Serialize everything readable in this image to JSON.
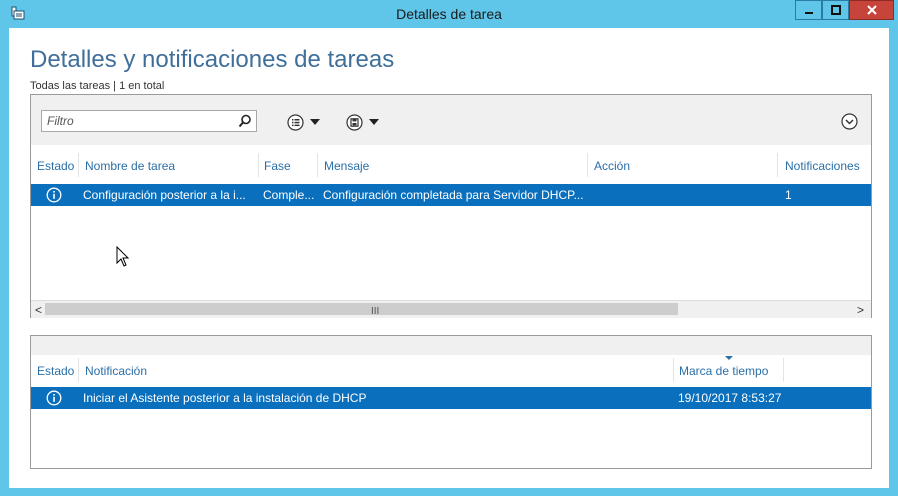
{
  "window": {
    "title": "Detalles de tarea",
    "icon": "server-manager-icon"
  },
  "controls": {
    "minimize": "minimize-icon",
    "maximize": "maximize-icon",
    "close": "close-icon"
  },
  "heading": "Detalles y notificaciones de tareas",
  "summary": "Todas las tareas | 1 en total",
  "toolbar": {
    "filter_placeholder": "Filtro",
    "search_icon": "search-icon",
    "list_icon": "list-options-icon",
    "save_icon": "save-icon",
    "expand_icon": "expand-chevron-icon"
  },
  "tasks": {
    "columns": [
      "Estado",
      "Nombre de tarea",
      "Fase",
      "Mensaje",
      "Acción",
      "Notificaciones"
    ],
    "rows": [
      {
        "status_icon": "info-icon",
        "name": "Configuración posterior a la i...",
        "phase": "Comple...",
        "message": "Configuración completada para Servidor DHCP...",
        "action": "",
        "notifications": "1"
      }
    ],
    "scroll": {
      "left": "<",
      "right": ">",
      "grip": "III"
    }
  },
  "notifications": {
    "columns": [
      "Estado",
      "Notificación",
      "Marca de tiempo"
    ],
    "rows": [
      {
        "status_icon": "info-icon",
        "text": "Iniciar el Asistente posterior a la instalación de DHCP",
        "timestamp": "19/10/2017 8:53:27"
      }
    ]
  },
  "colors": {
    "frame": "#5fc6ea",
    "heading": "#3f6f9a",
    "column_header": "#2a6fa8",
    "selected_row": "#0a6fbd",
    "close_button": "#c7443a"
  }
}
